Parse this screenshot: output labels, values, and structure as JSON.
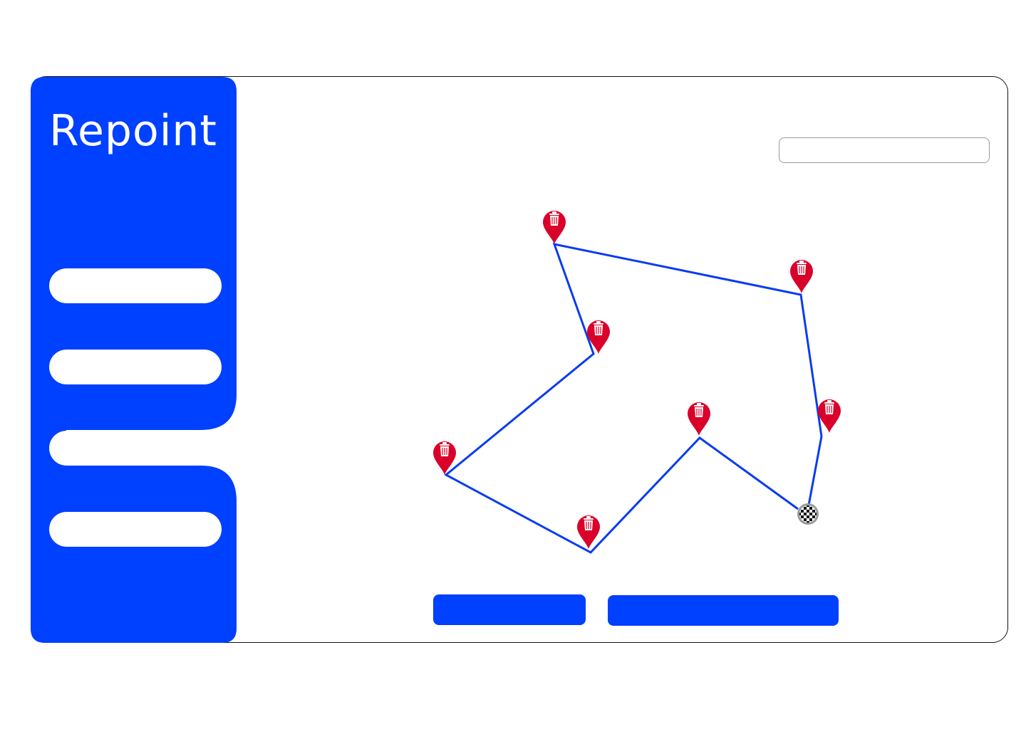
{
  "app": {
    "brand": "Repoint",
    "accent_color": "#0040FF",
    "route_color": "#0A3CF0",
    "pin_color": "#D9002A"
  },
  "sidebar": {
    "items": [
      {
        "label": "",
        "active": false
      },
      {
        "label": "",
        "active": false
      },
      {
        "label": "",
        "active": true
      },
      {
        "label": "",
        "active": false
      }
    ]
  },
  "search": {
    "value": "",
    "placeholder": ""
  },
  "map": {
    "stop_icon": "trash-bin-icon",
    "end_icon": "checkered-flag-icon"
  },
  "actions": {
    "primary_label": "",
    "secondary_label": ""
  }
}
